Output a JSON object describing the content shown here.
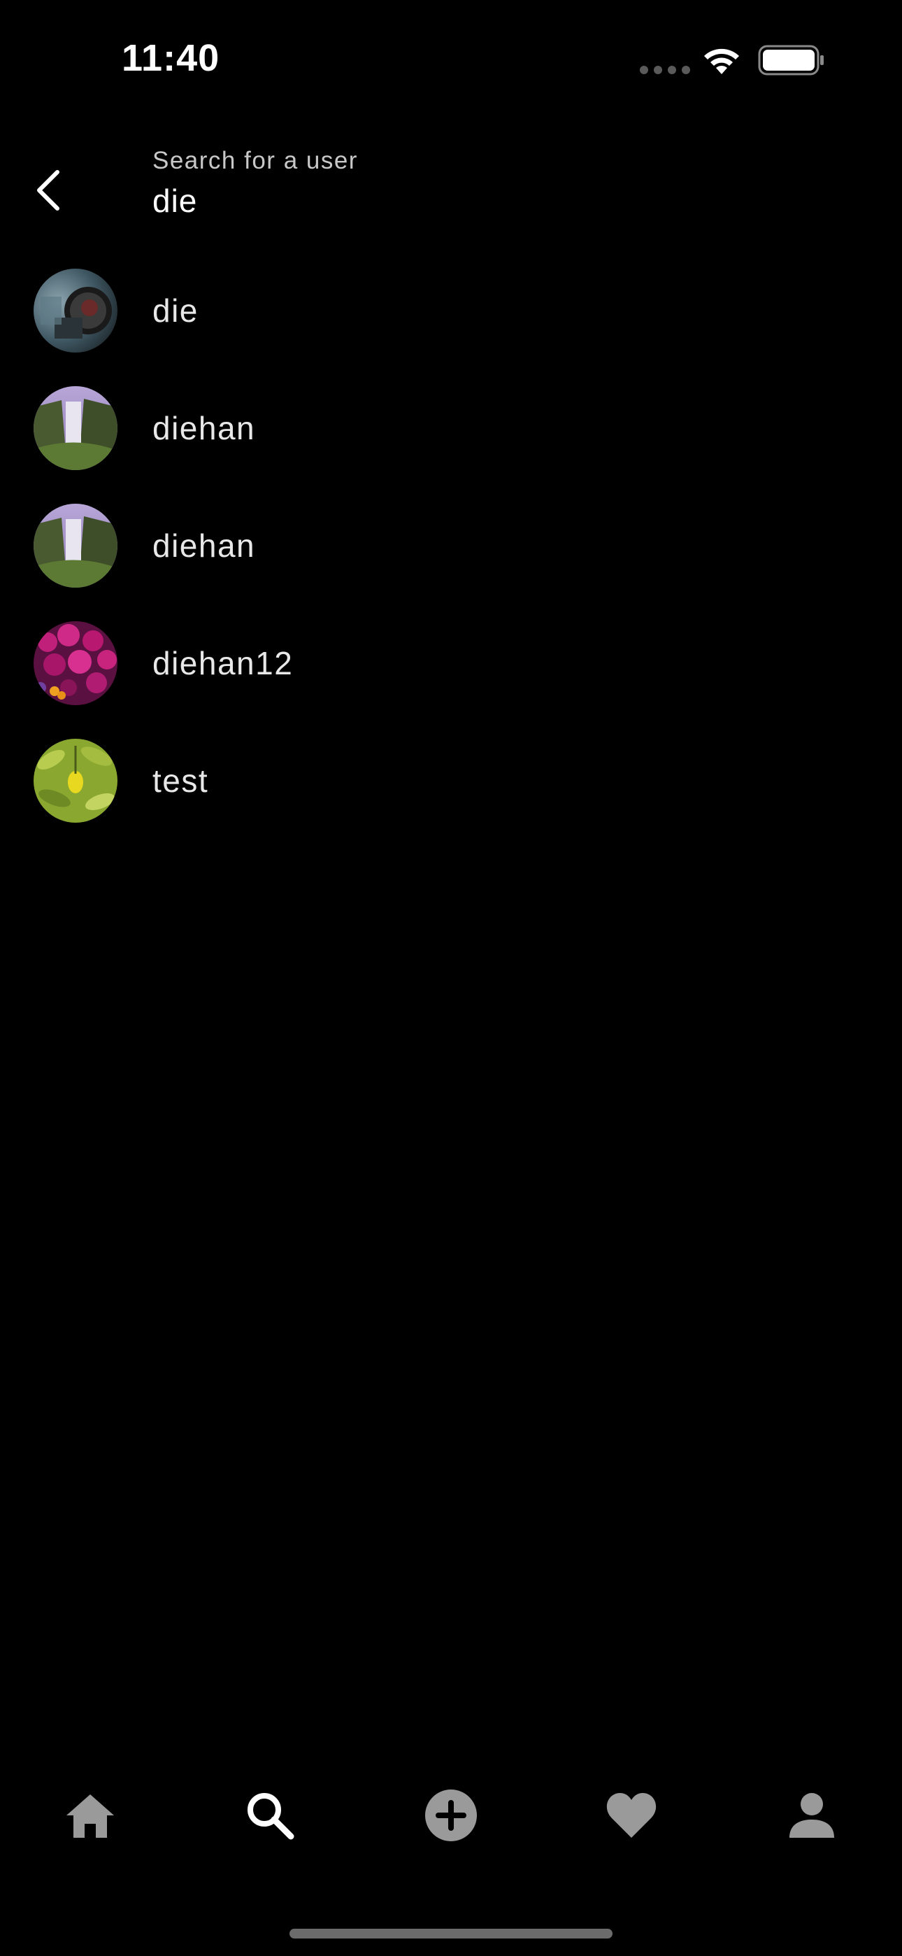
{
  "status_bar": {
    "time": "11:40",
    "icons": [
      "cellular-signal-icon",
      "wifi-icon",
      "battery-icon"
    ]
  },
  "search": {
    "label": "Search for a user",
    "value": "die"
  },
  "results": [
    {
      "username": "die",
      "avatar": "robot-machine-photo"
    },
    {
      "username": "diehan",
      "avatar": "waterfall-photo"
    },
    {
      "username": "diehan",
      "avatar": "waterfall-photo"
    },
    {
      "username": "diehan12",
      "avatar": "magenta-flowers-photo"
    },
    {
      "username": "test",
      "avatar": "lemon-tree-photo"
    }
  ],
  "bottom_nav": {
    "items": [
      "home-icon",
      "search-icon",
      "add-post-icon",
      "heart-icon",
      "profile-icon"
    ],
    "active": "search-icon",
    "active_color": "#ffffff",
    "inactive_color": "#9a9a9a"
  },
  "colors": {
    "background": "#000000",
    "text_primary": "#e8e8e8",
    "text_secondary": "#c8c8c8"
  }
}
